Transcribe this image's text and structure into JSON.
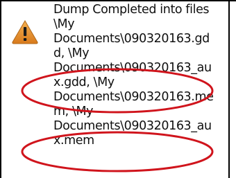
{
  "dialog": {
    "icon": "warning-icon",
    "message_lines": [
      "Dump Completed into files",
      "\\My",
      "Documents\\090320163.gd",
      "d, \\My",
      "Documents\\090320163_au",
      "x.gdd, \\My",
      "Documents\\090320163.me",
      "m, \\My",
      "Documents\\090320163_au",
      "x.mem"
    ]
  },
  "colors": {
    "highlight_ellipse": "#d0141c",
    "warning_fill": "#e08a2a",
    "warning_mark": "#1a1a1a"
  }
}
